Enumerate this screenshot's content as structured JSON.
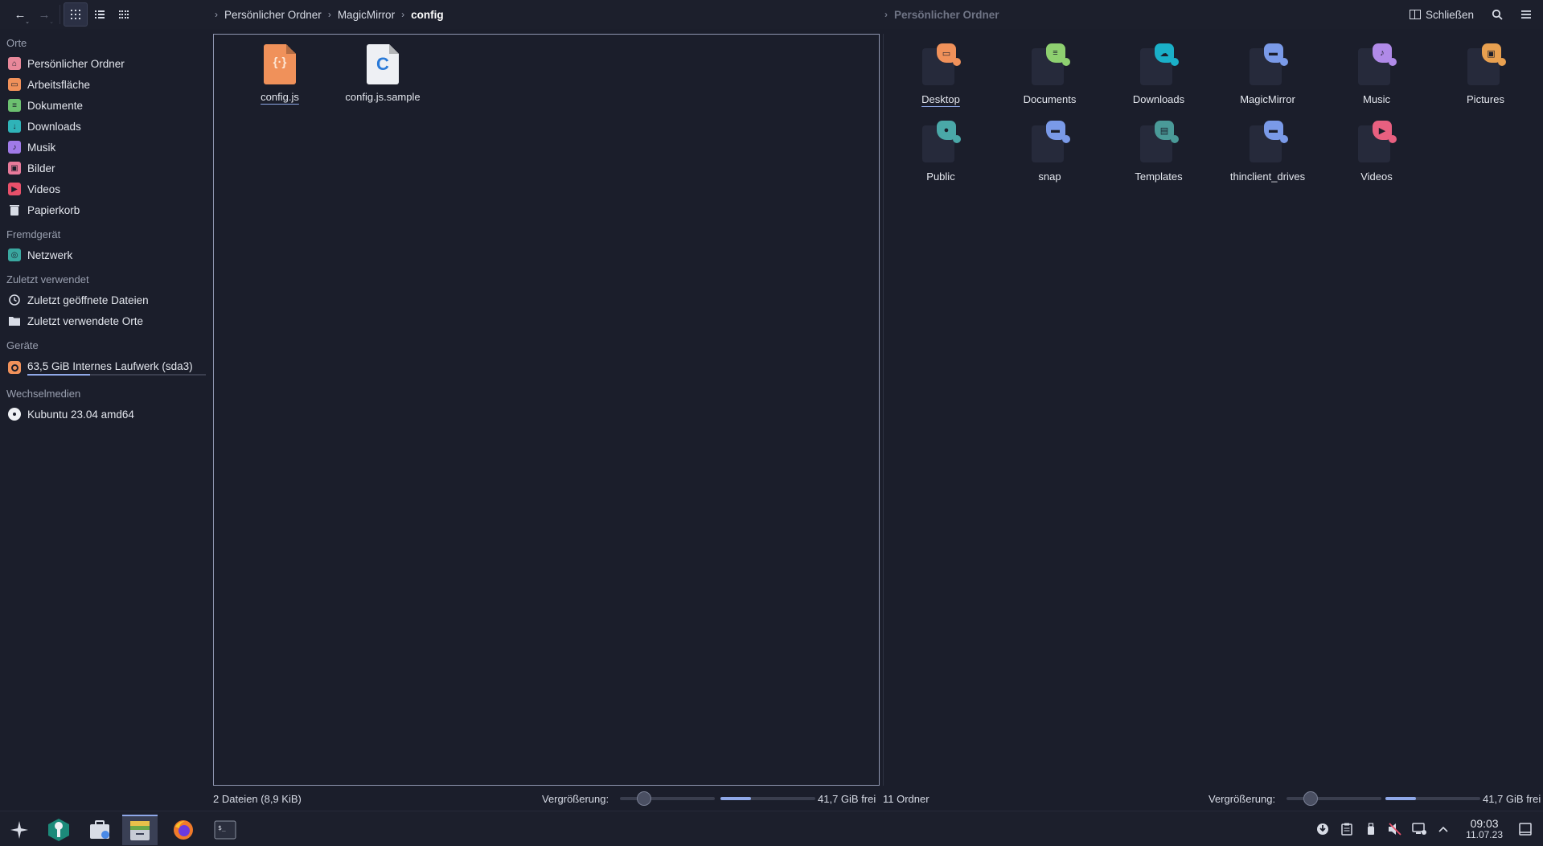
{
  "toolbar": {
    "view_icons": [
      "back-icon",
      "forward-icon",
      "icons-view-icon",
      "details-view-icon",
      "compact-view-icon"
    ],
    "breadcrumb_left": [
      "Persönlicher Ordner",
      "MagicMirror",
      "config"
    ],
    "breadcrumb_right": [
      "Persönlicher Ordner"
    ],
    "close_split_label": "Schließen"
  },
  "sidebar": {
    "sections": {
      "places": "Orte",
      "remote": "Fremdgerät",
      "recent": "Zuletzt verwendet",
      "devices": "Geräte",
      "removable": "Wechselmedien"
    },
    "places": [
      {
        "label": "Persönlicher Ordner",
        "icon": "home-icon",
        "color": "#e8889a"
      },
      {
        "label": "Arbeitsfläche",
        "icon": "desktop-folder-icon",
        "color": "#f0915a"
      },
      {
        "label": "Dokumente",
        "icon": "documents-folder-icon",
        "color": "#6cc070"
      },
      {
        "label": "Downloads",
        "icon": "downloads-folder-icon",
        "color": "#2fb3b8"
      },
      {
        "label": "Musik",
        "icon": "music-folder-icon",
        "color": "#a07ae8"
      },
      {
        "label": "Bilder",
        "icon": "pictures-folder-icon",
        "color": "#e87a9a"
      },
      {
        "label": "Videos",
        "icon": "videos-folder-icon",
        "color": "#e8506a"
      },
      {
        "label": "Papierkorb",
        "icon": "trash-icon",
        "color": "#d8dce6"
      }
    ],
    "remote": [
      {
        "label": "Netzwerk",
        "icon": "network-icon",
        "color": "#3aa8a0"
      }
    ],
    "recent": [
      {
        "label": "Zuletzt geöffnete Dateien",
        "icon": "clock-icon"
      },
      {
        "label": "Zuletzt verwendete Orte",
        "icon": "folder-icon"
      }
    ],
    "devices": [
      {
        "label": "63,5 GiB Internes Laufwerk (sda3)",
        "icon": "harddisk-icon",
        "usage_fraction": 0.35
      }
    ],
    "removable": [
      {
        "label": "Kubuntu 23.04 amd64",
        "icon": "optical-disc-icon"
      }
    ]
  },
  "left_panel": {
    "files": [
      {
        "name": "config.js",
        "type": "js",
        "color": "#f0915a",
        "glyph": "{·}"
      },
      {
        "name": "config.js.sample",
        "type": "c",
        "color": "#eef0f4",
        "glyph": "C"
      }
    ],
    "status": "2 Dateien (8,9 KiB)",
    "zoom_label": "Vergrößerung:",
    "zoom_fraction": 0.25,
    "free_space": "41,7 GiB frei",
    "used_fraction": 0.32
  },
  "right_panel": {
    "folders": [
      {
        "name": "Desktop",
        "color": "#f0915a",
        "icon": "desktop-icon"
      },
      {
        "name": "Documents",
        "color": "#8ed070",
        "icon": "document-icon"
      },
      {
        "name": "Downloads",
        "color": "#1ab0c8",
        "icon": "cloud-download-icon"
      },
      {
        "name": "MagicMirror",
        "color": "#7a9ae8",
        "icon": "folder-icon"
      },
      {
        "name": "Music",
        "color": "#b08ae8",
        "icon": "music-note-icon"
      },
      {
        "name": "Pictures",
        "color": "#e8a050",
        "icon": "image-icon"
      },
      {
        "name": "Public",
        "color": "#4aa8a8",
        "icon": "user-icon"
      },
      {
        "name": "snap",
        "color": "#7a9ae8",
        "icon": "folder-icon"
      },
      {
        "name": "Templates",
        "color": "#4a9a98",
        "icon": "template-icon"
      },
      {
        "name": "thinclient_drives",
        "color": "#7a9ae8",
        "icon": "folder-icon"
      },
      {
        "name": "Videos",
        "color": "#e86080",
        "icon": "video-icon"
      }
    ],
    "status": "11 Ordner",
    "zoom_label": "Vergrößerung:",
    "zoom_fraction": 0.25,
    "free_space": "41,7 GiB frei",
    "used_fraction": 0.32
  },
  "taskbar": {
    "apps": [
      "application-launcher-icon",
      "discover-icon",
      "software-center-icon",
      "dolphin-file-manager-icon",
      "firefox-icon",
      "terminal-icon"
    ],
    "active_app": "dolphin-file-manager-icon",
    "tray_icons": [
      "updates-icon",
      "clipboard-icon",
      "usb-device-icon",
      "volume-muted-icon",
      "network-wired-icon",
      "tray-expand-icon"
    ],
    "time": "09:03",
    "date": "11.07.23"
  }
}
